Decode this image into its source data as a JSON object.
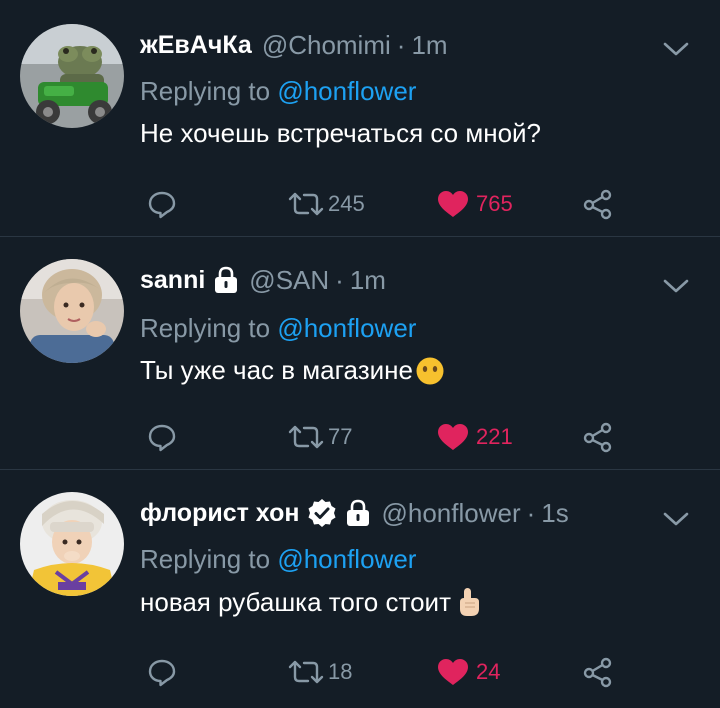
{
  "colors": {
    "background": "#141d26",
    "text_primary": "#ffffff",
    "text_secondary": "#8899a6",
    "link": "#1da1f2",
    "like": "#e0245e",
    "divider": "#2a3642"
  },
  "tweets": [
    {
      "display_name": "жЕвАчКа",
      "handle": "@Chomimi",
      "separator": "·",
      "time": "1m",
      "reply_prefix": "Replying to",
      "reply_to": "@honflower",
      "text": "Не хочешь встречаться со мной?",
      "retweets": "245",
      "likes": "765",
      "locked": false,
      "verified": false,
      "emoji": null
    },
    {
      "display_name": "sanni",
      "handle": "@SAN",
      "separator": "·",
      "time": "1m",
      "reply_prefix": "Replying to",
      "reply_to": "@honflower",
      "text": "Ты уже час в магазине",
      "retweets": "77",
      "likes": "221",
      "locked": true,
      "verified": false,
      "emoji": "face-without-mouth"
    },
    {
      "display_name": "флорист хон",
      "handle": "@honflower",
      "separator": "·",
      "time": "1s",
      "reply_prefix": "Replying to",
      "reply_to": "@honflower",
      "text": "новая рубашка того стоит",
      "retweets": "18",
      "likes": "24",
      "locked": true,
      "verified": true,
      "emoji": "index-pointing-up"
    }
  ],
  "icons": {
    "reply": "reply-icon",
    "retweet": "retweet-icon",
    "like": "heart-icon",
    "share": "share-icon",
    "more": "chevron-down-icon",
    "lock": "lock-icon",
    "verified": "verified-badge-icon"
  }
}
